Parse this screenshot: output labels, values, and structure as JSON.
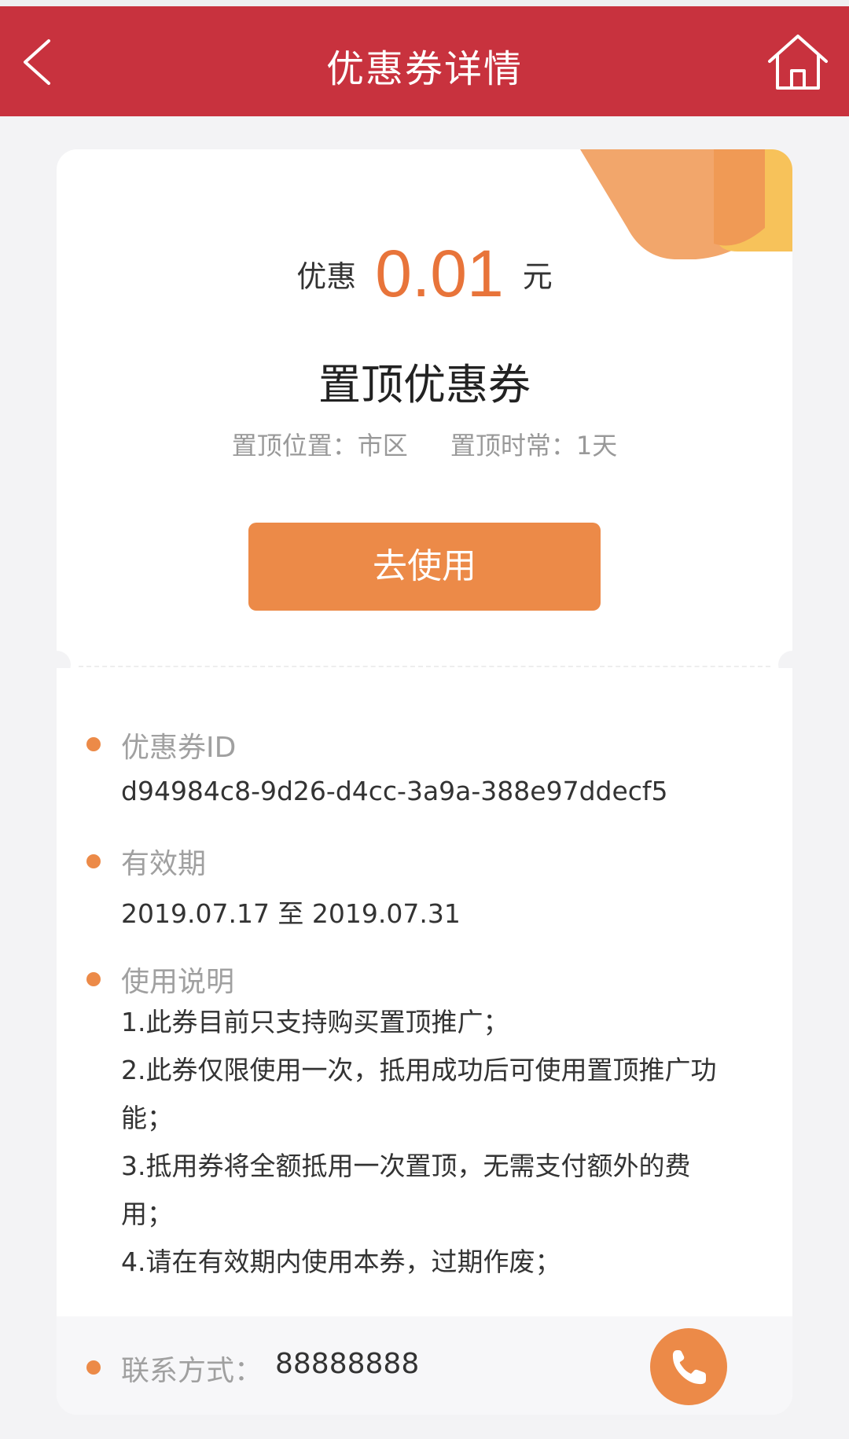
{
  "header": {
    "title": "优惠券详情"
  },
  "coupon": {
    "amount_prefix": "优惠",
    "amount": "0.01",
    "amount_unit": "元",
    "name": "置顶优惠券",
    "position_text": "置顶位置：市区",
    "duration_text": "置顶时常：1天",
    "use_button": "去使用"
  },
  "details": {
    "id_label": "优惠券ID",
    "id_value": "d94984c8-9d26-d4cc-3a9a-388e97ddecf5",
    "validity_label": "有效期",
    "validity_value": "2019.07.17 至 2019.07.31",
    "usage_label": "使用说明",
    "usage_lines": [
      "1.此券目前只支持购买置顶推广；",
      "2.此券仅限使用一次，抵用成功后可使用置顶推广功能；",
      "3.抵用券将全额抵用一次置顶，无需支付额外的费用；",
      "4.请在有效期内使用本券，过期作废；"
    ]
  },
  "contact": {
    "label": "联系方式：",
    "value": "88888888"
  },
  "colors": {
    "header": "#c8323e",
    "accent": "#ec8a48",
    "amount": "#e8743a"
  },
  "icons": {
    "back": "chevron-left-icon",
    "home": "home-icon",
    "phone": "phone-icon"
  }
}
